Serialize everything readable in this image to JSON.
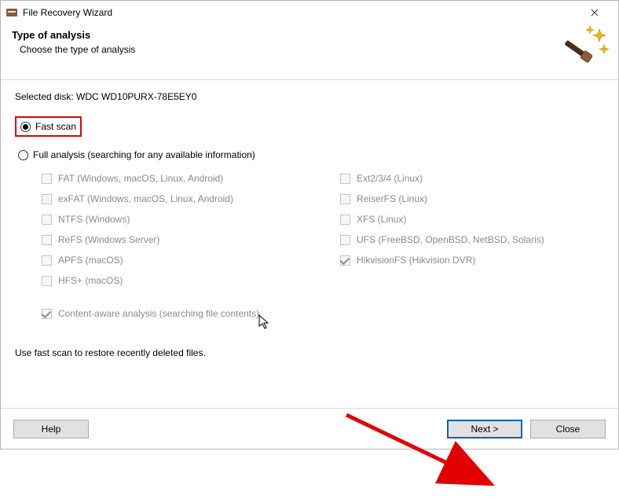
{
  "titlebar": {
    "title": "File Recovery Wizard"
  },
  "header": {
    "heading": "Type of analysis",
    "subtitle": "Choose the type of analysis"
  },
  "disk": {
    "label_prefix": "Selected disk: ",
    "name": "WDC WD10PURX-78E5EY0"
  },
  "options": {
    "fast_scan": "Fast scan",
    "full_analysis": "Full analysis (searching for any available information)",
    "content_aware": "Content-aware analysis (searching file contents)"
  },
  "filesystems": {
    "left": [
      "FAT (Windows, macOS, Linux, Android)",
      "exFAT (Windows, macOS, Linux, Android)",
      "NTFS (Windows)",
      "ReFS (Windows Server)",
      "APFS (macOS)",
      "HFS+ (macOS)"
    ],
    "right": [
      "Ext2/3/4 (Linux)",
      "ReiserFS (Linux)",
      "XFS (Linux)",
      "UFS (FreeBSD, OpenBSD, NetBSD, Solaris)",
      "HikvisionFS (Hikvision DVR)"
    ]
  },
  "hint": "Use fast scan to restore recently deleted files.",
  "buttons": {
    "help": "Help",
    "next": "Next >",
    "close": "Close"
  }
}
